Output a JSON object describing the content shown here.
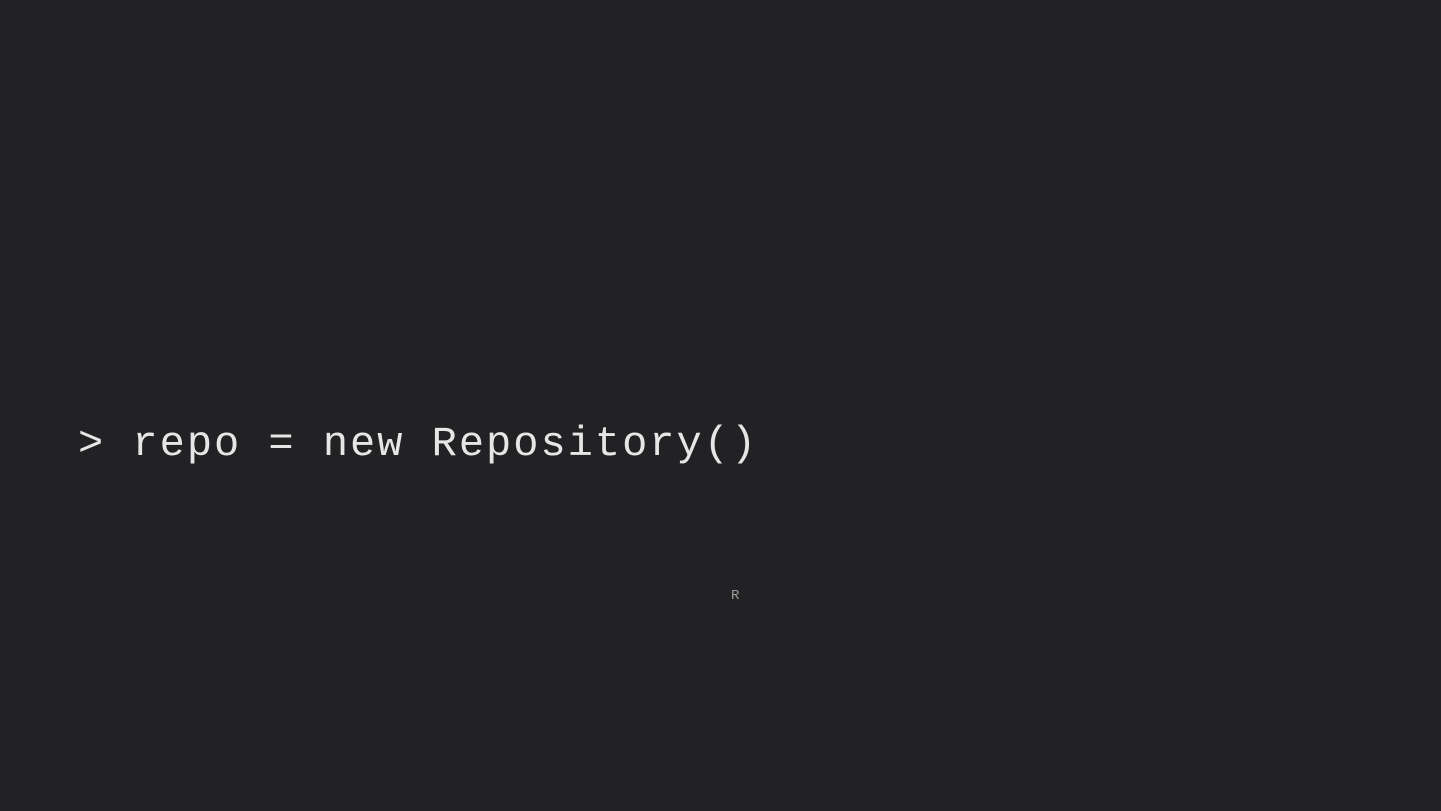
{
  "slide": {
    "code": "> repo = new Repository()",
    "stray": "R"
  },
  "colors": {
    "background": "#222224",
    "text": "#e6e6e6",
    "stray": "#9a9a9a"
  }
}
